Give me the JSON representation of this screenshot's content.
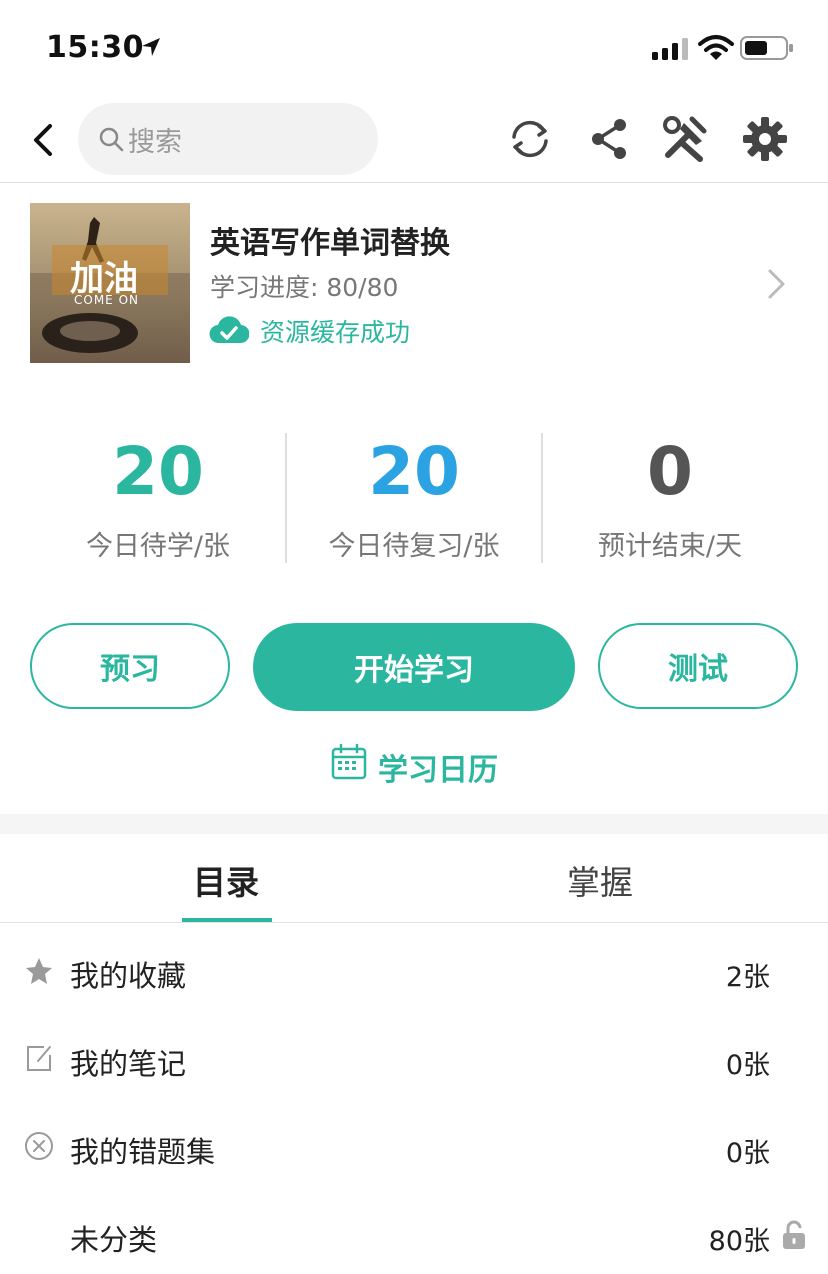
{
  "status_bar": {
    "time": "15:30"
  },
  "nav": {
    "search_placeholder": "搜索"
  },
  "book": {
    "title": "英语写作单词替换",
    "progress": "学习进度: 80/80",
    "cache_status": "资源缓存成功",
    "cover_text": "加油",
    "cover_subtext": "COME ON"
  },
  "stats": [
    {
      "value": "20",
      "label": "今日待学/张",
      "color": "#2bb79f"
    },
    {
      "value": "20",
      "label": "今日待复习/张",
      "color": "#2ba3e3"
    },
    {
      "value": "0",
      "label": "预计结束/天",
      "color": "#555555"
    }
  ],
  "actions": {
    "preview": "预习",
    "start": "开始学习",
    "test": "测试",
    "calendar": "学习日历"
  },
  "tabs": [
    {
      "label": "目录"
    },
    {
      "label": "掌握"
    }
  ],
  "list": [
    {
      "label": "我的收藏",
      "count": "2张",
      "icon": "star-icon"
    },
    {
      "label": "我的笔记",
      "count": "0张",
      "icon": "edit-note-icon"
    },
    {
      "label": "我的错题集",
      "count": "0张",
      "icon": "circle-x-icon"
    },
    {
      "label": "未分类",
      "count": "80张",
      "icon": "lock-icon"
    }
  ],
  "colors": {
    "accent": "#2bb79f",
    "review_blue": "#2ba3e3"
  }
}
